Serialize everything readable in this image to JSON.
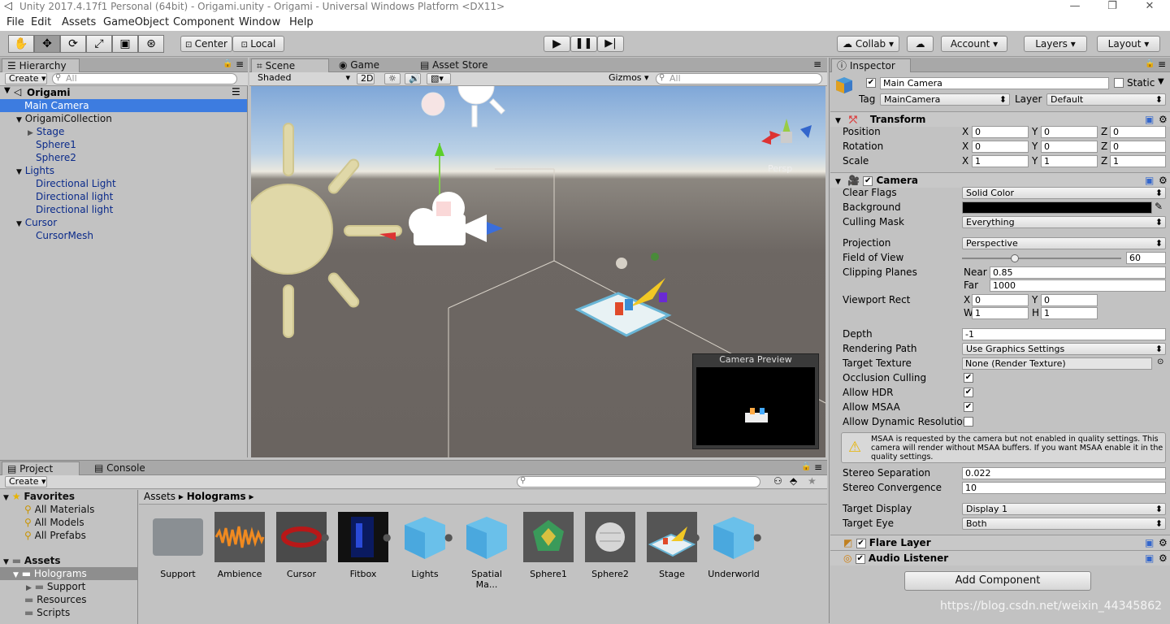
{
  "window": {
    "title": "Unity 2017.4.17f1 Personal (64bit) - Origami.unity - Origami - Universal Windows Platform <DX11>"
  },
  "menu": [
    "File",
    "Edit",
    "Assets",
    "GameObject",
    "Component",
    "Window",
    "Help"
  ],
  "toolbar": {
    "center": "Center",
    "local": "Local",
    "collab": "Collab",
    "account": "Account",
    "layers": "Layers",
    "layout": "Layout"
  },
  "hierarchy": {
    "tab": "Hierarchy",
    "create": "Create",
    "search": "All",
    "scene": "Origami",
    "items": [
      {
        "label": "Main Camera"
      },
      {
        "label": "OrigamiCollection"
      },
      {
        "label": "Stage"
      },
      {
        "label": "Sphere1"
      },
      {
        "label": "Sphere2"
      },
      {
        "label": "Lights"
      },
      {
        "label": "Directional Light"
      },
      {
        "label": "Directional light"
      },
      {
        "label": "Directional light"
      },
      {
        "label": "Cursor"
      },
      {
        "label": "CursorMesh"
      }
    ]
  },
  "scene": {
    "tabs": [
      "Scene",
      "Game",
      "Asset Store"
    ],
    "shaded": "Shaded",
    "mode2d": "2D",
    "gizmos": "Gizmos",
    "search": "All",
    "persp": "Persp",
    "preview_title": "Camera Preview"
  },
  "project": {
    "tabs": [
      "Project",
      "Console"
    ],
    "create": "Create",
    "favorites": "Favorites",
    "fav_items": [
      "All Materials",
      "All Models",
      "All Prefabs"
    ],
    "assets": "Assets",
    "tree": [
      "Holograms",
      "Support",
      "Resources",
      "Scripts"
    ],
    "breadcrumb": [
      "Assets",
      "Holograms"
    ],
    "items": [
      {
        "label": "Support"
      },
      {
        "label": "Ambience"
      },
      {
        "label": "Cursor"
      },
      {
        "label": "Fitbox"
      },
      {
        "label": "Lights"
      },
      {
        "label": "Spatial Ma..."
      },
      {
        "label": "Sphere1"
      },
      {
        "label": "Sphere2"
      },
      {
        "label": "Stage"
      },
      {
        "label": "Underworld"
      }
    ]
  },
  "inspector": {
    "tab": "Inspector",
    "name": "Main Camera",
    "static": "Static",
    "tag_label": "Tag",
    "tag": "MainCamera",
    "layer_label": "Layer",
    "layer": "Default",
    "transform": {
      "title": "Transform",
      "rows": [
        {
          "label": "Position",
          "x": "0",
          "y": "0",
          "z": "0"
        },
        {
          "label": "Rotation",
          "x": "0",
          "y": "0",
          "z": "0"
        },
        {
          "label": "Scale",
          "x": "1",
          "y": "1",
          "z": "1"
        }
      ]
    },
    "camera": {
      "title": "Camera",
      "clear_flags_label": "Clear Flags",
      "clear_flags": "Solid Color",
      "background_label": "Background",
      "culling_label": "Culling Mask",
      "culling": "Everything",
      "projection_label": "Projection",
      "projection": "Perspective",
      "fov_label": "Field of View",
      "fov": "60",
      "clip_label": "Clipping Planes",
      "near_label": "Near",
      "near": "0.85",
      "far_label": "Far",
      "far": "1000",
      "viewport_label": "Viewport Rect",
      "vx": "0",
      "vy": "0",
      "vw": "1",
      "vh": "1",
      "depth_label": "Depth",
      "depth": "-1",
      "render_path_label": "Rendering Path",
      "render_path": "Use Graphics Settings",
      "target_tex_label": "Target Texture",
      "target_tex": "None (Render Texture)",
      "occlusion_label": "Occlusion Culling",
      "hdr_label": "Allow HDR",
      "msaa_label": "Allow MSAA",
      "dynres_label": "Allow Dynamic Resolution",
      "warning": "MSAA is requested by the camera but not enabled in quality settings. This camera will render without MSAA buffers. If you want MSAA enable it in the quality settings.",
      "stereo_sep_label": "Stereo Separation",
      "stereo_sep": "0.022",
      "stereo_conv_label": "Stereo Convergence",
      "stereo_conv": "10",
      "target_display_label": "Target Display",
      "target_display": "Display 1",
      "target_eye_label": "Target Eye",
      "target_eye": "Both"
    },
    "flare": "Flare Layer",
    "audio": "Audio Listener",
    "add_component": "Add Component"
  },
  "watermark": "https://blog.csdn.net/weixin_44345862",
  "colors": {
    "selection": "#3d7ce0",
    "link": "#0a2a8a"
  }
}
